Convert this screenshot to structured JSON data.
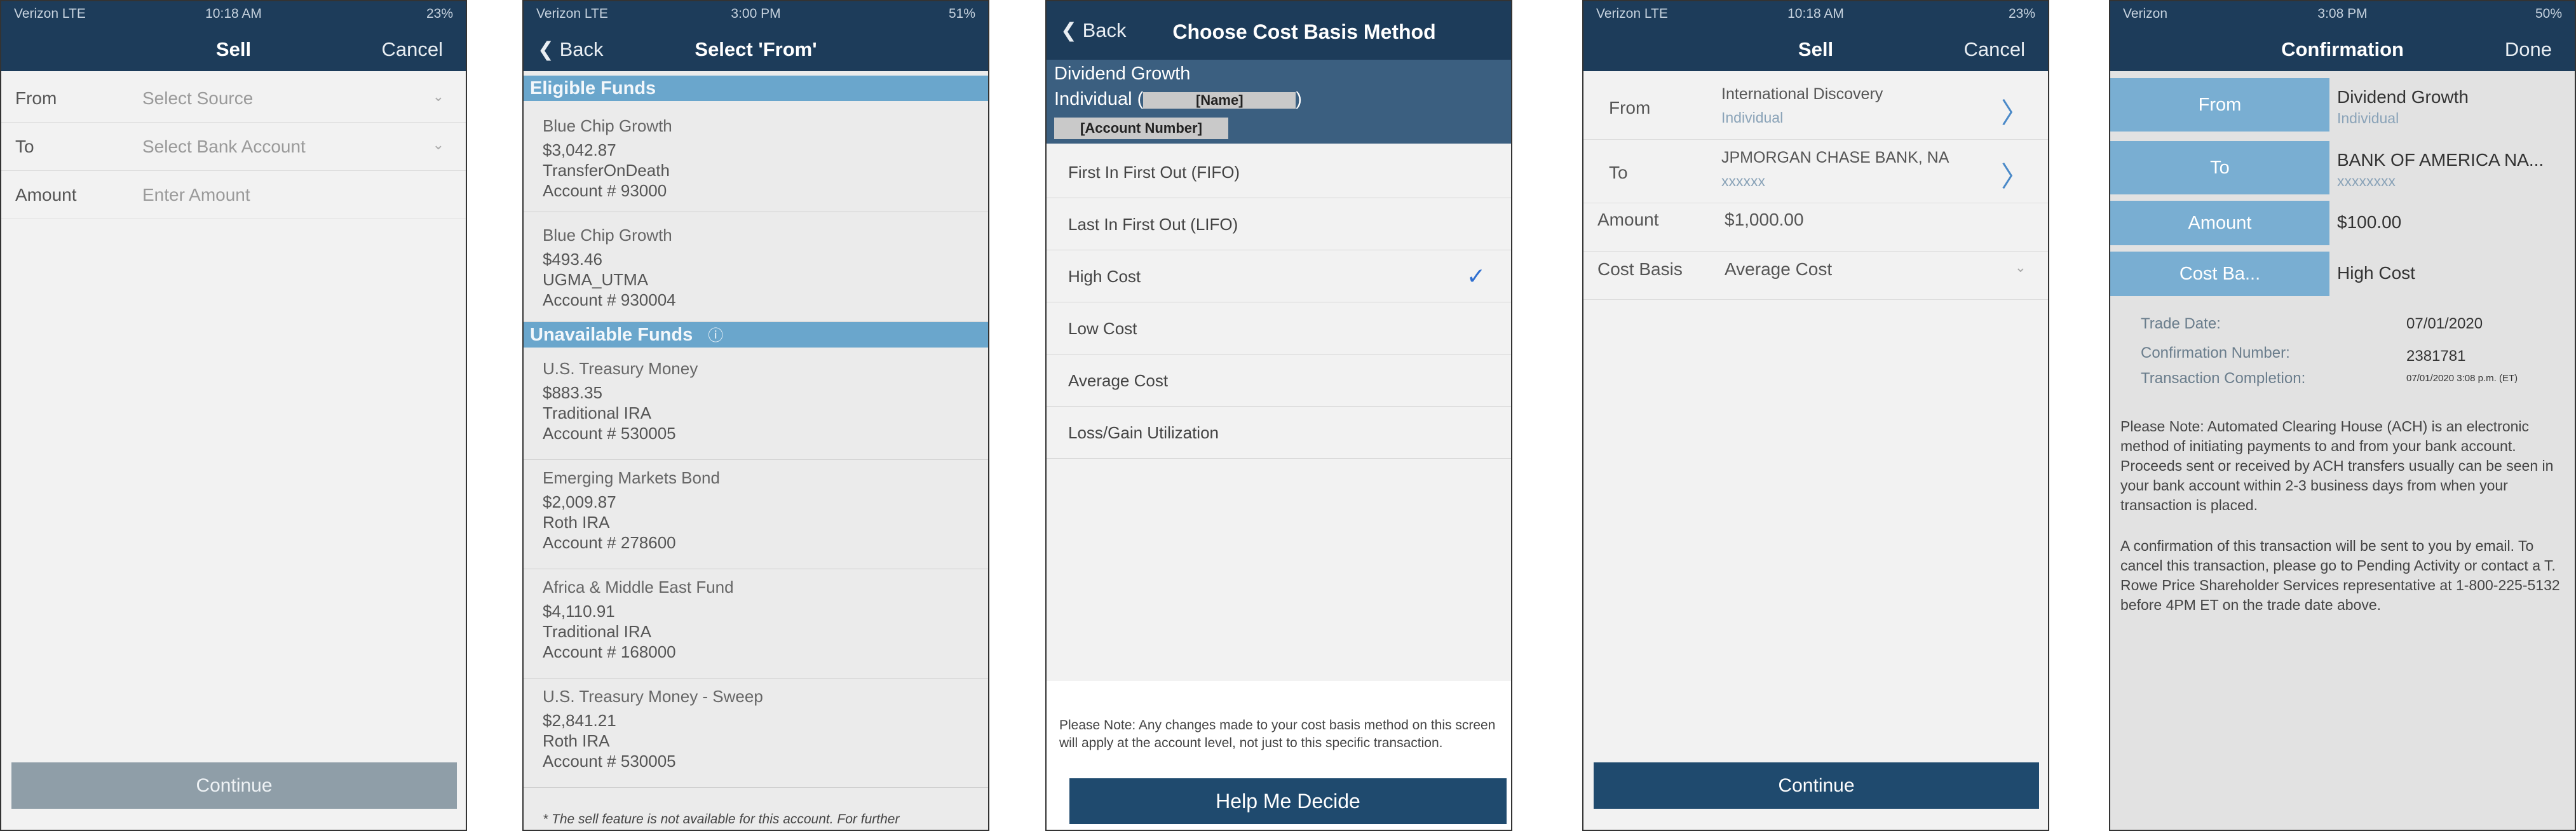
{
  "screen1": {
    "status": {
      "carrier": "Verizon  LTE",
      "time": "10:18 AM",
      "battery": "23%"
    },
    "nav": {
      "title": "Sell",
      "right": "Cancel"
    },
    "rows": [
      {
        "label": "From",
        "placeholder": "Select Source"
      },
      {
        "label": "To",
        "placeholder": "Select Bank Account"
      },
      {
        "label": "Amount",
        "placeholder": "Enter Amount"
      }
    ],
    "continue": "Continue"
  },
  "screen2": {
    "status": {
      "carrier": "Verizon  LTE",
      "time": "3:00 PM",
      "battery": "51%"
    },
    "nav": {
      "back": "Back",
      "title": "Select 'From'"
    },
    "eligible_header": "Eligible Funds",
    "eligible": [
      {
        "name": "Blue Chip Growth",
        "amount": "$3,042.87",
        "type": "TransferOnDeath",
        "account": "Account # 93000"
      },
      {
        "name": "Blue Chip Growth",
        "amount": "$493.46",
        "type": "UGMA_UTMA",
        "account": "Account # 930004"
      }
    ],
    "unavailable_header": "Unavailable Funds",
    "unavailable": [
      {
        "name": "U.S. Treasury Money",
        "amount": "$883.35",
        "type": "Traditional IRA",
        "account": "Account # 530005"
      },
      {
        "name": "Emerging Markets Bond",
        "amount": "$2,009.87",
        "type": "Roth IRA",
        "account": "Account # 278600"
      },
      {
        "name": "Africa & Middle East Fund",
        "amount": "$4,110.91",
        "type": "Traditional IRA",
        "account": "Account # 168000"
      },
      {
        "name": "U.S. Treasury Money - Sweep",
        "amount": "$2,841.21",
        "type": "Roth IRA",
        "account": "Account # 530005"
      }
    ],
    "footnote": "* The sell feature is not available for this account. For further"
  },
  "screen3": {
    "nav": {
      "back": "Back",
      "title": "Choose Cost Basis Method"
    },
    "fund": "Dividend Growth",
    "individual_prefix": "Individual (",
    "individual_suffix": ")",
    "name_redacted": "[Name]",
    "account_redacted": "[Account Number]",
    "methods": [
      "First In First Out (FIFO)",
      "Last In First Out (LIFO)",
      "High Cost",
      "Low Cost",
      "Average Cost",
      "Loss/Gain Utilization"
    ],
    "checked_index": 2,
    "check": "✓",
    "note": "Please Note: Any changes made to your cost basis method on this screen will apply at the account level, not just to this specific transaction.",
    "help_button": "Help Me Decide"
  },
  "screen4": {
    "status": {
      "carrier": "Verizon  LTE",
      "time": "10:18 AM",
      "battery": "23%"
    },
    "nav": {
      "title": "Sell",
      "right": "Cancel"
    },
    "from": {
      "label": "From",
      "line1": "International Discovery",
      "line2": "Individual"
    },
    "to": {
      "label": "To",
      "line1": "JPMORGAN CHASE BANK, NA",
      "line2": "xxxxxx"
    },
    "amount": {
      "label": "Amount",
      "value": "$1,000.00"
    },
    "cost_basis": {
      "label": "Cost Basis",
      "value": "Average Cost"
    },
    "continue": "Continue"
  },
  "screen5": {
    "status": {
      "carrier": "Verizon",
      "time": "3:08 PM",
      "battery": "50%"
    },
    "nav": {
      "title": "Confirmation",
      "right": "Done"
    },
    "rows": [
      {
        "label": "From",
        "value": "Dividend Growth",
        "sub": "Individual"
      },
      {
        "label": "To",
        "value": "BANK OF AMERICA NA...",
        "sub": "xxxxxxxx"
      },
      {
        "label": "Amount",
        "value": "$100.00",
        "sub": ""
      },
      {
        "label": "Cost Ba...",
        "value": "High Cost",
        "sub": ""
      }
    ],
    "details": [
      {
        "key": "Trade Date:",
        "value": "07/01/2020"
      },
      {
        "key": "Confirmation Number:",
        "value": "2381781"
      },
      {
        "key": "Transaction Completion:",
        "value": "07/01/2020 3:08 p.m. (ET)"
      }
    ],
    "note1": "Please Note: Automated Clearing House (ACH) is an electronic method of initiating payments to and from your bank account. Proceeds sent or received by ACH transfers usually can be seen in your bank account within 2-3 business days from when your transaction is placed.",
    "note2": "A confirmation of this transaction will be sent to you by email. To cancel this transaction, please go to Pending Activity or contact a T. Rowe Price Shareholder Services representative at 1-800-225-5132 before 4PM ET on the trade date above."
  }
}
